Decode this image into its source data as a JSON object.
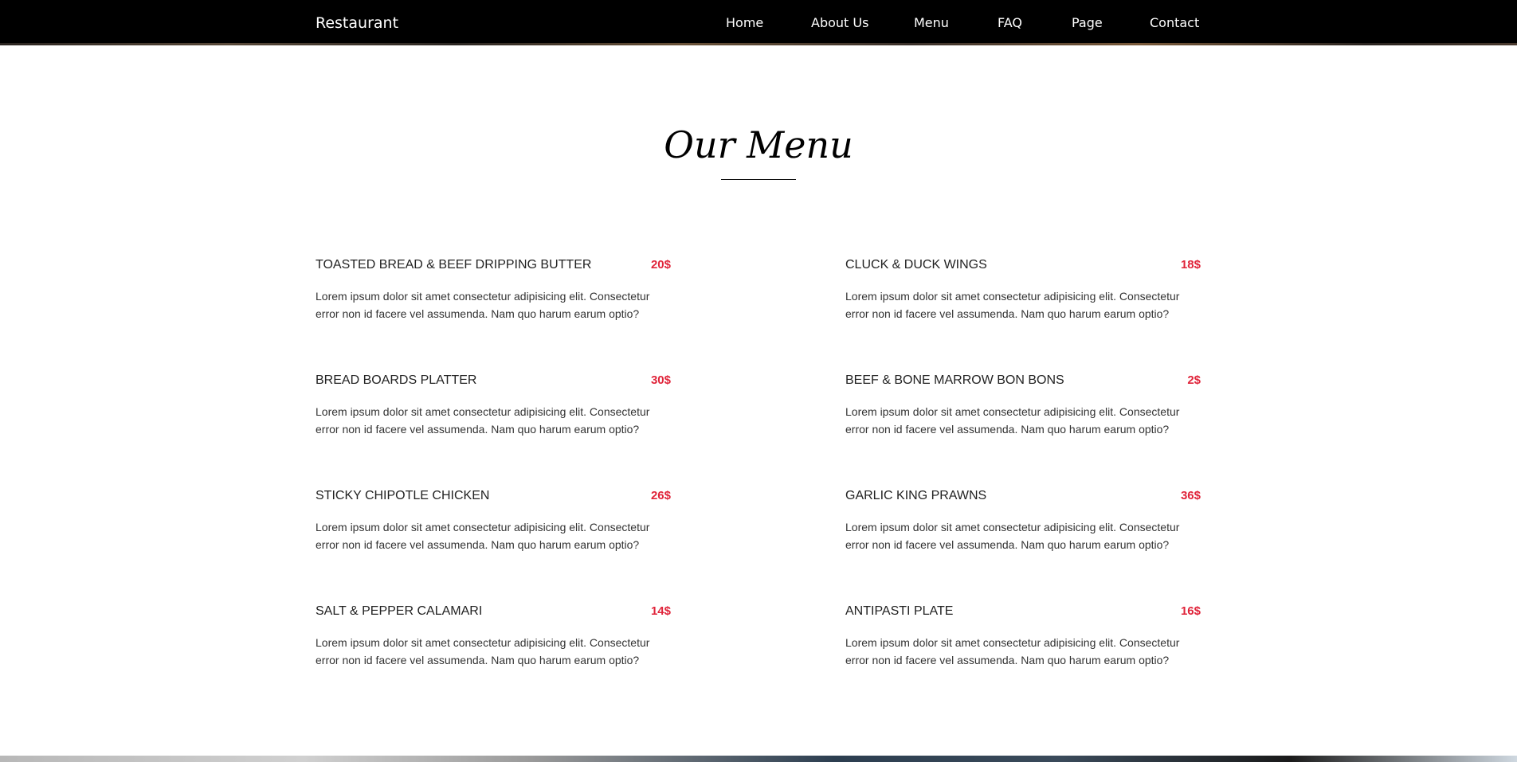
{
  "navbar": {
    "brand": "Restaurant",
    "links": [
      "Home",
      "About Us",
      "Menu",
      "FAQ",
      "Page",
      "Contact"
    ]
  },
  "section": {
    "title": "Our Menu"
  },
  "menu": {
    "items": [
      {
        "name": "TOASTED BREAD & BEEF DRIPPING BUTTER",
        "price": "20$",
        "description": "Lorem ipsum dolor sit amet consectetur adipisicing elit. Consectetur error non id facere vel assumenda. Nam quo harum earum optio?"
      },
      {
        "name": "CLUCK & DUCK WINGS",
        "price": "18$",
        "description": "Lorem ipsum dolor sit amet consectetur adipisicing elit. Consectetur error non id facere vel assumenda. Nam quo harum earum optio?"
      },
      {
        "name": "BREAD BOARDS PLATTER",
        "price": "30$",
        "description": "Lorem ipsum dolor sit amet consectetur adipisicing elit. Consectetur error non id facere vel assumenda. Nam quo harum earum optio?"
      },
      {
        "name": "BEEF & BONE MARROW BON BONS",
        "price": "2$",
        "description": "Lorem ipsum dolor sit amet consectetur adipisicing elit. Consectetur error non id facere vel assumenda. Nam quo harum earum optio?"
      },
      {
        "name": "STICKY CHIPOTLE CHICKEN",
        "price": "26$",
        "description": "Lorem ipsum dolor sit amet consectetur adipisicing elit. Consectetur error non id facere vel assumenda. Nam quo harum earum optio?"
      },
      {
        "name": "GARLIC KING PRAWNS",
        "price": "36$",
        "description": "Lorem ipsum dolor sit amet consectetur adipisicing elit. Consectetur error non id facere vel assumenda. Nam quo harum earum optio?"
      },
      {
        "name": "SALT & PEPPER CALAMARI",
        "price": "14$",
        "description": "Lorem ipsum dolor sit amet consectetur adipisicing elit. Consectetur error non id facere vel assumenda. Nam quo harum earum optio?"
      },
      {
        "name": "ANTIPASTI PLATE",
        "price": "16$",
        "description": "Lorem ipsum dolor sit amet consectetur adipisicing elit. Consectetur error non id facere vel assumenda. Nam quo harum earum optio?"
      }
    ]
  },
  "colors": {
    "navbar_bg": "#000000",
    "price": "#e0243a",
    "text": "#222222"
  }
}
